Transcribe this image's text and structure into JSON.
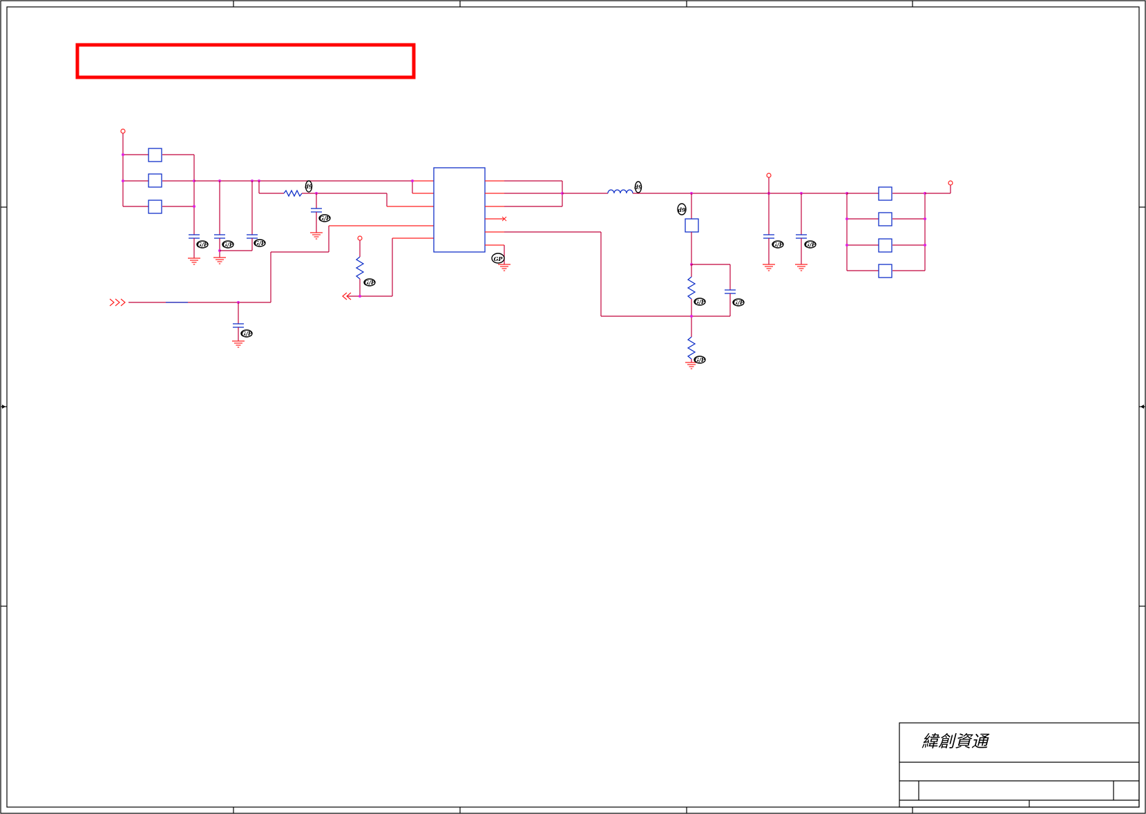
{
  "title_block": {
    "company_name": "緯創資通"
  },
  "badges": {
    "green_part": "G/P",
    "gp_marker": "GP",
    "debug_marker": "d9"
  },
  "colors": {
    "wire": "#c0003a",
    "pin": "#ff1f1f",
    "component": "#1030c8",
    "junction": "#e020e0",
    "highlight_box": "#ff0000",
    "frame": "#000000"
  },
  "icons": {
    "ground": "ground-symbol-icon",
    "power_port": "power-port-icon",
    "off_page_in": "offpage-in-arrow-icon",
    "off_page_out": "offpage-out-arrow-icon",
    "no_connect": "no-connect-x-icon"
  }
}
